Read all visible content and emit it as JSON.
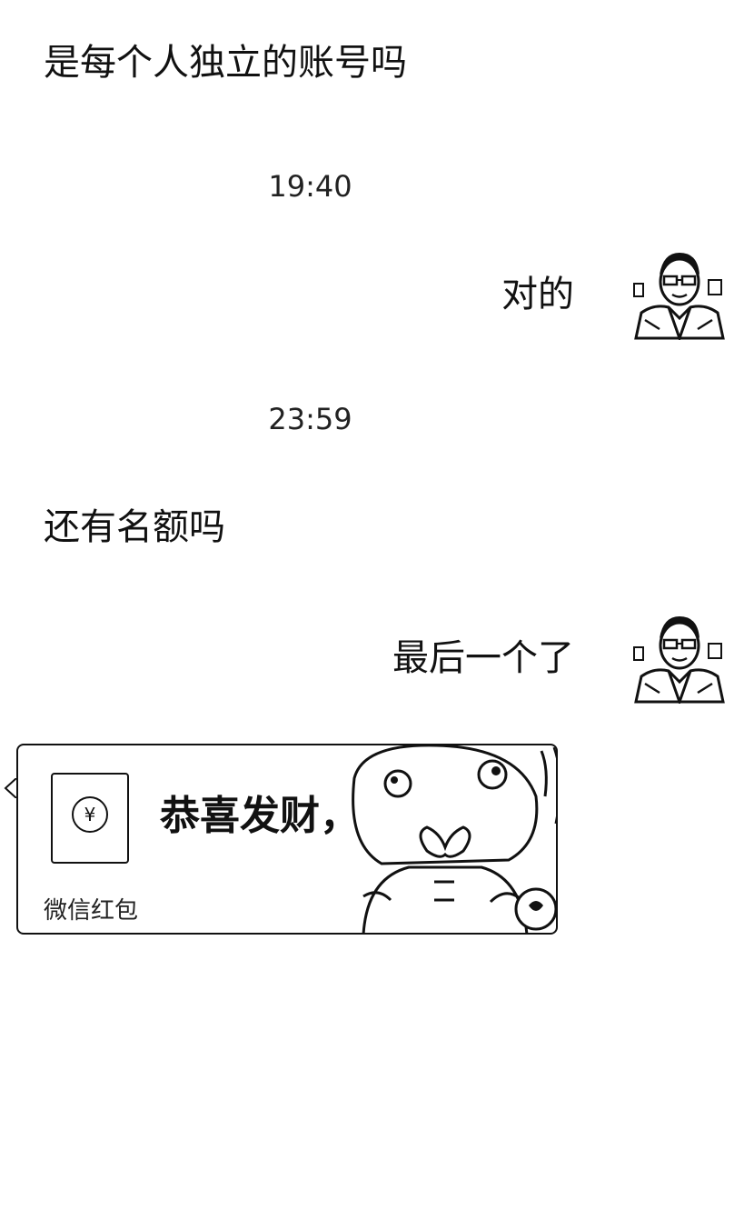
{
  "messages": [
    {
      "side": "left",
      "text": "是每个人独立的账号吗"
    },
    {
      "timestamp": "19:40"
    },
    {
      "side": "right",
      "text": "对的"
    },
    {
      "timestamp": "23:59"
    },
    {
      "side": "left",
      "text": "还有名额吗"
    },
    {
      "side": "right",
      "text": "最后一个了"
    }
  ],
  "red_packet": {
    "title": "恭喜发财，大吉大利",
    "label": "微信红包",
    "icon": "yuan-coin-icon",
    "coin_symbol": "¥"
  },
  "avatar": {
    "icon": "user-avatar-icon"
  },
  "colors": {
    "text": "#111111",
    "background": "#ffffff"
  }
}
